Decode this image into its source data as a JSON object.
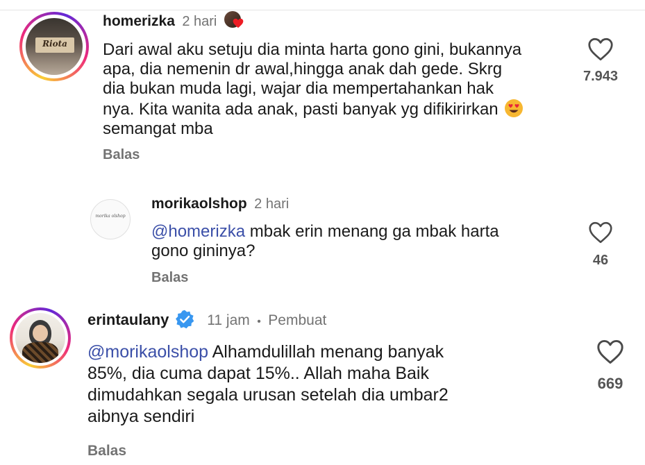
{
  "comments": [
    {
      "username": "homerizka",
      "time": "2 hari",
      "text_lines": [
        "Dari awal aku setuju dia minta harta gono gini, bukannya",
        "apa, dia nemenin dr awal,hingga anak dah gede. Skrg",
        "dia bukan muda lagi, wajar dia mempertahankan hak",
        "nya. Kita wanita ada anak, pasti banyak yg difikirirkan",
        "semangat mba"
      ],
      "emoji": "heart-eyes-emoji",
      "like_count": "7.943",
      "reply_label": "Balas",
      "avatar_logo_text": "Riota"
    },
    {
      "username": "morikaolshop",
      "time": "2 hari",
      "mention": "@homerizka",
      "text_line1_rest": " mbak erin menang ga mbak harta",
      "text_line2": "gono gininya?",
      "like_count": "46",
      "reply_label": "Balas",
      "avatar_logo_text": "morika olshop"
    },
    {
      "username": "erintaulany",
      "time": "11 jam",
      "separator": "•",
      "creator_label": "Pembuat",
      "mention": "@morikaolshop",
      "text_line1_rest": " Alhamdulillah menang banyak",
      "text_lines_rest": [
        "85%, dia cuma dapat 15%.. Allah maha Baik",
        "dimudahkan segala urusan setelah dia umbar2",
        "aibnya sendiri"
      ],
      "like_count": "669",
      "reply_label": "Balas",
      "verified": true
    }
  ],
  "colors": {
    "mention": "#3b4fa8",
    "verified": "#3897f0",
    "muted": "#737373"
  }
}
